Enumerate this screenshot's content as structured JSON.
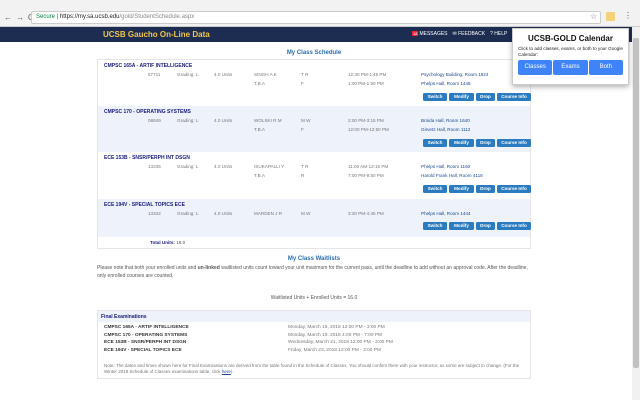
{
  "browser": {
    "secure_label": "Secure",
    "url_domain": "https://my.sa.ucsb.edu",
    "url_path": "/gold/StudentSchedule.aspx"
  },
  "header": {
    "brand": "UCSB Gaucho On-Line Data",
    "messages_count": "18",
    "messages": "MESSAGES",
    "feedback": "FEEDBACK",
    "help": "HELP"
  },
  "popup": {
    "title": "UCSB-GOLD Calendar",
    "text": "Click to add classes, exams, or both to your Google Calendar:",
    "buttons": [
      "Classes",
      "Exams",
      "Both"
    ]
  },
  "schedule": {
    "title": "My Class Schedule",
    "buttons": [
      "Switch",
      "Modify",
      "Drop",
      "Course Info"
    ],
    "total_label": "Total Units:",
    "total_value": "16.0",
    "courses": [
      {
        "name": "CMPSC 165A - ARTIF INTELLIGENCE",
        "number": "57711",
        "grading": "Grading: L",
        "units": "4.0 Units",
        "sessions": [
          {
            "instructor": "SINGH A K",
            "days": "T R",
            "time": "12:30 PM-1:45 PM",
            "location": "Psychology Building, Room 1924"
          },
          {
            "instructor": "T.B.A",
            "days": "F",
            "time": "1:00 PM-1:50 PM",
            "location": "Phelps Hall, Room 1448"
          }
        ]
      },
      {
        "name": "CMPSC 170 - OPERATING SYSTEMS",
        "number": "08649",
        "grading": "Grading: L",
        "units": "4.0 Units",
        "sessions": [
          {
            "instructor": "WOLSKI R M",
            "days": "M W",
            "time": "2:00 PM-3:15 PM",
            "location": "Broida Hall, Room 1640"
          },
          {
            "instructor": "T.B.A",
            "days": "F",
            "time": "12:00 PM-12:50 PM",
            "location": "Girvetz Hall, Room 1112"
          }
        ]
      },
      {
        "name": "ECE 153B - SNSR/PERPH INT DSGN",
        "number": "13235",
        "grading": "Grading: L",
        "units": "4.0 Units",
        "sessions": [
          {
            "instructor": "ISUKAPALLI Y",
            "days": "T R",
            "time": "11:00 AM-12:15 PM",
            "location": "Phelps Hall, Room 1160"
          },
          {
            "instructor": "T.B.A",
            "days": "R",
            "time": "7:00 PM-9:50 PM",
            "location": "Harold Frank Hall, Room 4118"
          }
        ]
      },
      {
        "name": "ECE 194V - SPECIAL TOPICS ECE",
        "number": "13342",
        "grading": "Grading: L",
        "units": "4.0 Units",
        "sessions": [
          {
            "instructor": "MARDEN J R",
            "days": "M W",
            "time": "3:30 PM-4:45 PM",
            "location": "Phelps Hall, Room 1444"
          }
        ]
      }
    ]
  },
  "waitlists": {
    "title": "My Class Waitlists",
    "note_pre": "Please note that both your enrolled units and ",
    "note_bold": "un-linked",
    "note_post": " waitlisted units count toward your unit maximum for the current pass, until the deadline to add without an approval code. After the deadline, only enrolled courses are counted.",
    "formula": "Waitlisted Units + Enrolled Units = 16.0"
  },
  "finals": {
    "title": "Final Examinations",
    "rows": [
      {
        "course": "CMPSC 165A - ARTIF INTELLIGENCE",
        "date": "Monday, March 19, 2018 12:00 PM - 3:00 PM"
      },
      {
        "course": "CMPSC 170 - OPERATING SYSTEMS",
        "date": "Monday, March 19, 2018 4:00 PM - 7:00 PM"
      },
      {
        "course": "ECE 153B - SNSR/PERPH INT DSGN",
        "date": "Wednesday, March 21, 2018 12:00 PM - 3:00 PM"
      },
      {
        "course": "ECE 194V - SPECIAL TOPICS ECE",
        "date": "Friday, March 23, 2018 12:00 PM - 3:00 PM"
      }
    ],
    "note": "Note: The dates and times shown here for Final Examinations are derived from the table found in the Schedule of Classes. You should confirm them with your instructor, as some are subject to change. (For the Winter 2018 Schedule of Classes examinations table, click ",
    "link": "here",
    "note_end": ")."
  }
}
